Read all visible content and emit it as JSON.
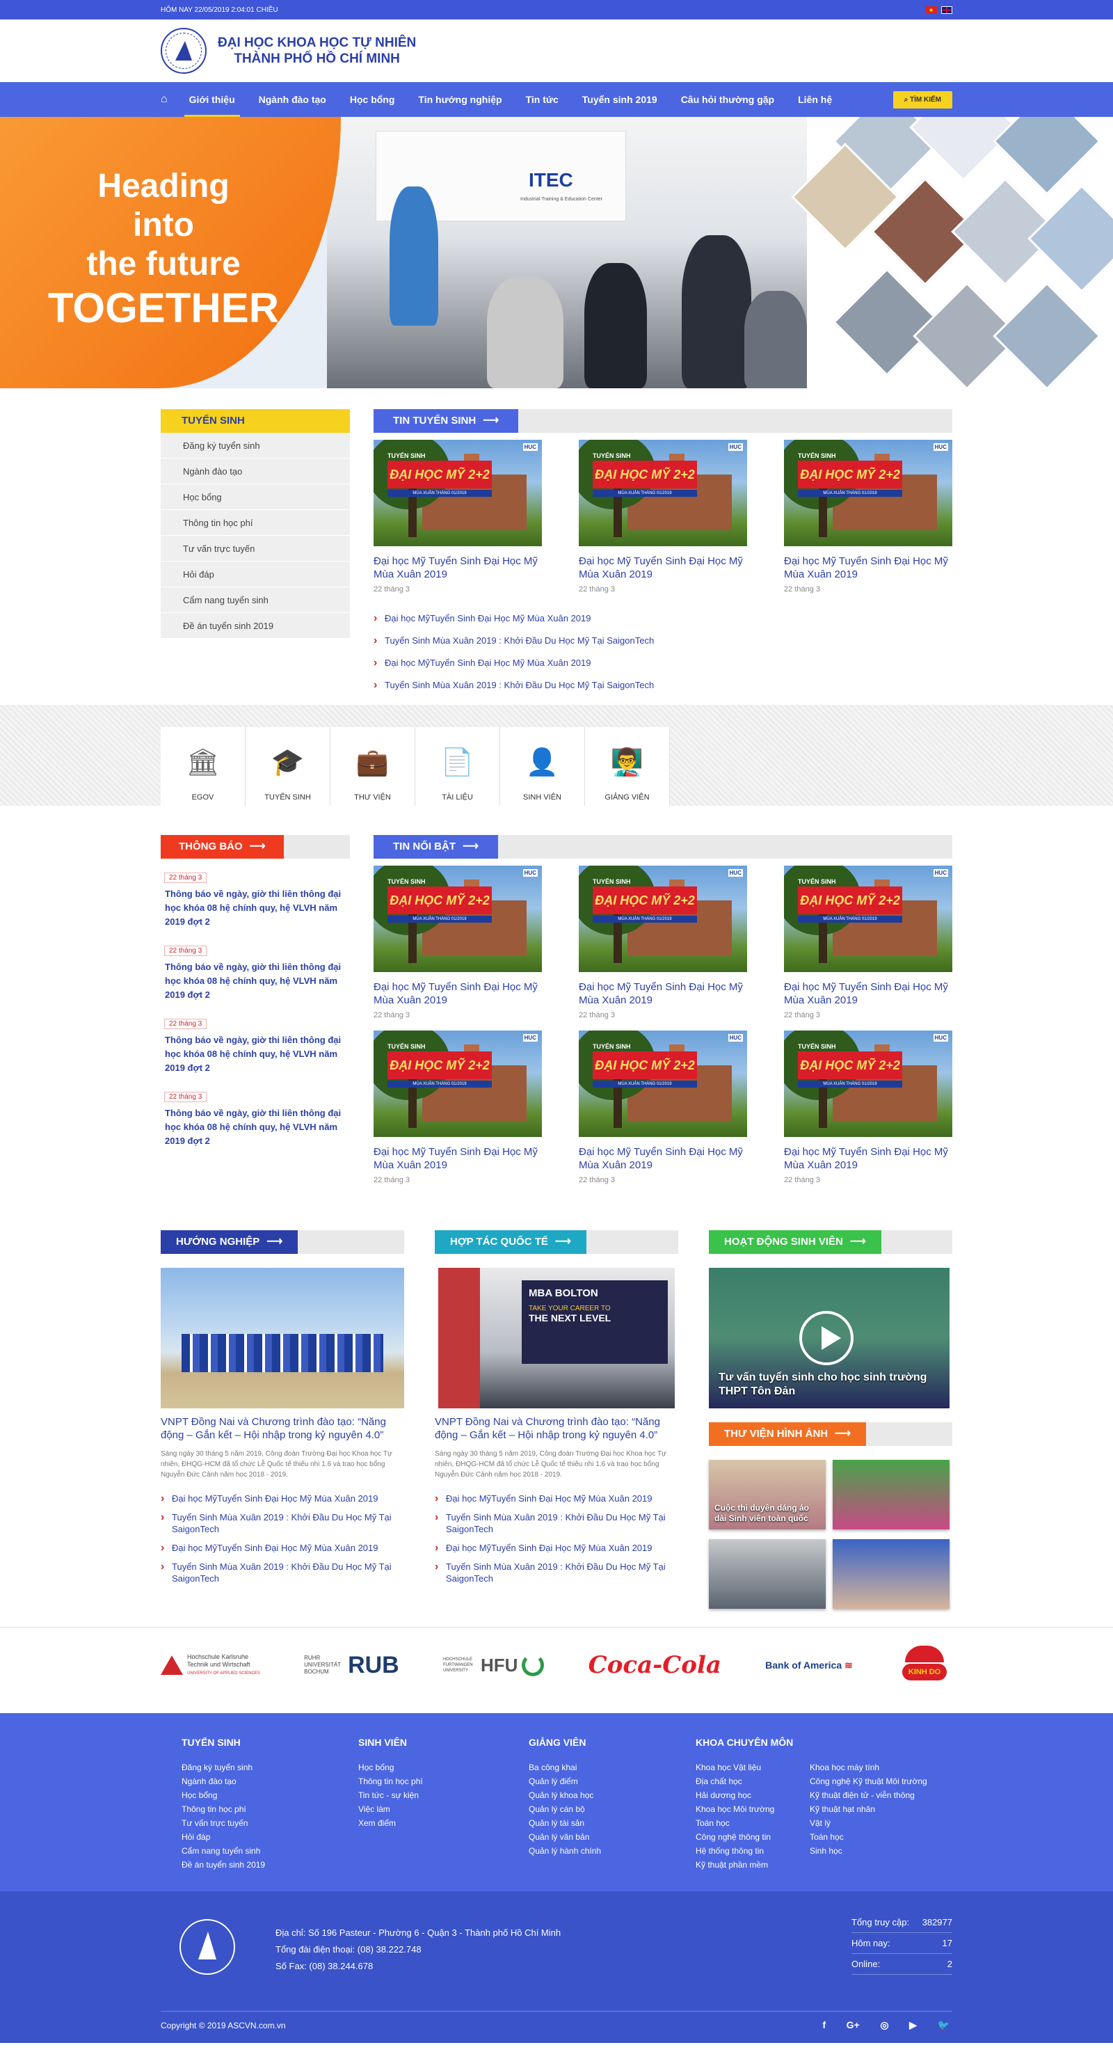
{
  "topbar": {
    "date": "HÔM NAY 22/05/2019 2:04:01 CHIỀU"
  },
  "header": {
    "name_line1": "ĐẠI HỌC KHOA HỌC TỰ NHIÊN",
    "name_line2": "THÀNH PHỐ HỒ CHÍ MINH"
  },
  "nav": {
    "items": [
      "Giới thiệu",
      "Ngành đào tạo",
      "Học bổng",
      "Tin hướng nghiệp",
      "Tin tức",
      "Tuyển sinh 2019",
      "Câu hỏi thường gặp",
      "Liên hệ"
    ],
    "search": "TÌM KIẾM"
  },
  "hero": {
    "line1": "Heading",
    "line2": "into",
    "line3": "the future",
    "line4": "TOGETHER",
    "itec": "ITEC",
    "itec_sub": "Industrial Training & Education Center"
  },
  "sidebar": {
    "title": "TUYỂN SINH",
    "items": [
      "Đăng ký tuyển sinh",
      "Ngành đào tạo",
      "Học bổng",
      "Thông tin học phí",
      "Tư vấn trực tuyến",
      "Hỏi đáp",
      "Cẩm nang tuyển sinh",
      "Đề án tuyển sinh 2019"
    ]
  },
  "admissions": {
    "title": "TIN TUYỂN SINH",
    "cards": [
      {
        "title": "Đại học Mỹ Tuyển Sinh Đại Học Mỹ Mùa Xuân 2019",
        "date": "22 tháng 3"
      },
      {
        "title": "Đại học Mỹ Tuyển Sinh Đại Học Mỹ Mùa Xuân 2019",
        "date": "22 tháng 3"
      },
      {
        "title": "Đại học Mỹ Tuyển Sinh Đại Học Mỹ Mùa Xuân 2019",
        "date": "22 tháng 3"
      }
    ],
    "links": [
      "Đại học MỹTuyển Sinh Đại Học Mỹ Mùa Xuân 2019",
      "Tuyển Sinh Mùa Xuân 2019 : Khởi Đầu Du Học Mỹ Tại SaigonTech",
      "Đại học MỹTuyển Sinh Đại Học Mỹ Mùa Xuân 2019",
      "Tuyển Sinh Mùa Xuân 2019 : Khởi Đầu Du Học Mỹ Tại SaigonTech"
    ]
  },
  "thumb": {
    "label_top": "TUYỂN SINH",
    "banner": "ĐẠI HỌC MỸ 2+2",
    "strip": "MÙA XUÂN THÁNG 01/2019",
    "brand": "HUC"
  },
  "quicklinks": [
    "EGOV",
    "TUYỂN SINH",
    "THƯ VIỆN",
    "TÀI LIỆU",
    "SINH VIÊN",
    "GIẢNG VIÊN"
  ],
  "notices": {
    "title": "THÔNG BÁO",
    "items": [
      {
        "date": "22 tháng 3",
        "text": "Thông báo về ngày, giờ thi liên thông đại học khóa 08 hệ chính quy, hệ VLVH năm 2019 đợt 2"
      },
      {
        "date": "22 tháng 3",
        "text": "Thông báo về ngày, giờ thi liên thông đại học khóa 08 hệ chính quy, hệ VLVH năm 2019 đợt 2"
      },
      {
        "date": "22 tháng 3",
        "text": "Thông báo về ngày, giờ thi liên thông đại học khóa 08 hệ chính quy, hệ VLVH năm 2019 đợt 2"
      },
      {
        "date": "22 tháng 3",
        "text": "Thông báo về ngày, giờ thi liên thông đại học khóa 08 hệ chính quy, hệ VLVH năm 2019 đợt 2"
      }
    ]
  },
  "featured": {
    "title": "TIN NỔI BẬT",
    "card_title": "Đại học Mỹ Tuyển Sinh Đại Học Mỹ Mùa Xuân 2019",
    "card_date": "22 tháng 3"
  },
  "career": {
    "title": "HƯỚNG NGHIỆP",
    "headline": "VNPT Đồng Nai và Chương trình đào tạo: “Năng động – Gắn kết – Hội nhập trong kỷ nguyên 4.0”",
    "excerpt": "Sáng ngày 30 tháng 5 năm 2019, Công đoàn Trường Đại học Khoa học Tự nhiên, ĐHQG-HCM đã tổ chức Lễ Quốc tế thiếu nhi 1.6 và trao học bổng Nguyễn Đức Cảnh năm học 2018 - 2019.",
    "links": [
      "Đại học MỹTuyển Sinh Đại Học Mỹ Mùa Xuân 2019",
      "Tuyển Sinh Mùa Xuân 2019 : Khởi Đầu Du Học Mỹ Tại SaigonTech",
      "Đại học MỹTuyển Sinh Đại Học Mỹ Mùa Xuân 2019",
      "Tuyển Sinh Mùa Xuân 2019 : Khởi Đầu Du Học Mỹ Tại SaigonTech"
    ]
  },
  "intl": {
    "title": "HỢP TÁC QUỐC TẾ",
    "headline": "VNPT Đồng Nai và Chương trình đào tạo: “Năng động – Gắn kết – Hội nhập trong kỷ nguyên 4.0”",
    "excerpt": "Sáng ngày 30 tháng 5 năm 2019, Công đoàn Trường Đại học Khoa học Tự nhiên, ĐHQG-HCM đã tổ chức Lễ Quốc tế thiếu nhi 1.6 và trao học bổng Nguyễn Đức Cảnh năm học 2018 - 2019.",
    "links": [
      "Đại học MỹTuyển Sinh Đại Học Mỹ Mùa Xuân 2019",
      "Tuyển Sinh Mùa Xuân 2019 : Khởi Đầu Du Học Mỹ Tại SaigonTech",
      "Đại học MỹTuyển Sinh Đại Học Mỹ Mùa Xuân 2019",
      "Tuyển Sinh Mùa Xuân 2019 : Khởi Đầu Du Học Mỹ Tại SaigonTech"
    ],
    "banner1": "MBA BOLTON",
    "banner2": "TAKE YOUR CAREER TO",
    "banner3": "THE NEXT LEVEL"
  },
  "student": {
    "title": "HOẠT ĐỘNG SINH VIÊN",
    "video_caption": "Tư vấn tuyển sinh cho học sinh trường THPT Tôn Đản",
    "gallery_title": "THƯ VIỆN HÌNH ẢNH",
    "gallery_caption": "Cuộc thi duyên dáng áo dài Sinh viên toàn quốc"
  },
  "partners": {
    "kit_line1": "Hochschule Karlsruhe",
    "kit_line2": "Technik und Wirtschaft",
    "kit_line3": "UNIVERSITY OF APPLIED SCIENCES",
    "rub_small1": "RUHR",
    "rub_small2": "UNIVERSITÄT",
    "rub_small3": "BOCHUM",
    "rub": "RUB",
    "hfu_small": "HOCHSCHULE FURTWANGEN UNIVERSITY",
    "hfu": "HFU",
    "coca": "Coca-Cola",
    "boa": "Bank of America",
    "kinhdo": "KINH DO"
  },
  "footer": {
    "cols": [
      {
        "title": "TUYỂN SINH",
        "items": [
          "Đăng ký tuyển sinh",
          "Ngành đào tạo",
          "Học bổng",
          "Thông tin học phí",
          "Tư vấn trực tuyến",
          "Hỏi đáp",
          "Cẩm nang tuyển sinh",
          "Đề án tuyển sinh 2019"
        ]
      },
      {
        "title": "SINH VIÊN",
        "items": [
          "Học bổng",
          "Thông tin học phí",
          "Tin tức - sự kiện",
          "Việc làm",
          "Xem điểm"
        ]
      },
      {
        "title": "GIẢNG VIÊN",
        "items": [
          "Ba công khai",
          "Quản lý điểm",
          "Quản lý khoa học",
          "Quản lý cán bộ",
          "Quản lý tài sản",
          "Quản lý văn bản",
          "Quản lý hành chính"
        ]
      },
      {
        "title": "KHOA CHUYÊN MÔN",
        "items": [
          "Khoa học Vật liệu",
          "Địa chất học",
          "Hải dương học",
          "Khoa học Môi trường",
          "Toán học",
          "Công nghệ thông tin",
          "Hệ thống thông tin",
          "Kỹ thuật phần mềm"
        ],
        "items2": [
          "Khoa học máy tính",
          "Công nghệ Kỹ thuật Môi trường",
          "Kỹ thuật điện tử - viễn thông",
          "Kỹ thuật hạt nhân",
          "Vật lý",
          "Toán học",
          "Sinh học"
        ]
      }
    ],
    "address": "Địa chỉ: Số 196 Pasteur - Phường 6 - Quận 3 - Thành phố Hồ Chí Minh",
    "phone": "Tổng đài điện thoại: (08) 38.222.748",
    "fax": "Số Fax: (08) 38.244.678",
    "stats": [
      {
        "label": "Tổng truy cập:",
        "value": "382977"
      },
      {
        "label": "Hôm nay:",
        "value": "17"
      },
      {
        "label": "Online:",
        "value": "2"
      }
    ],
    "copyright": "Copyright © 2019 ASCVN.com.vn",
    "social": [
      "f",
      "G+",
      "◎",
      "▶",
      "🐦"
    ]
  },
  "colors": {
    "primary": "#4b66e0",
    "accent": "#f6d11d",
    "red": "#f03a1f",
    "teal": "#1fa8c4",
    "green": "#3ac24a",
    "orange": "#f26f22"
  }
}
